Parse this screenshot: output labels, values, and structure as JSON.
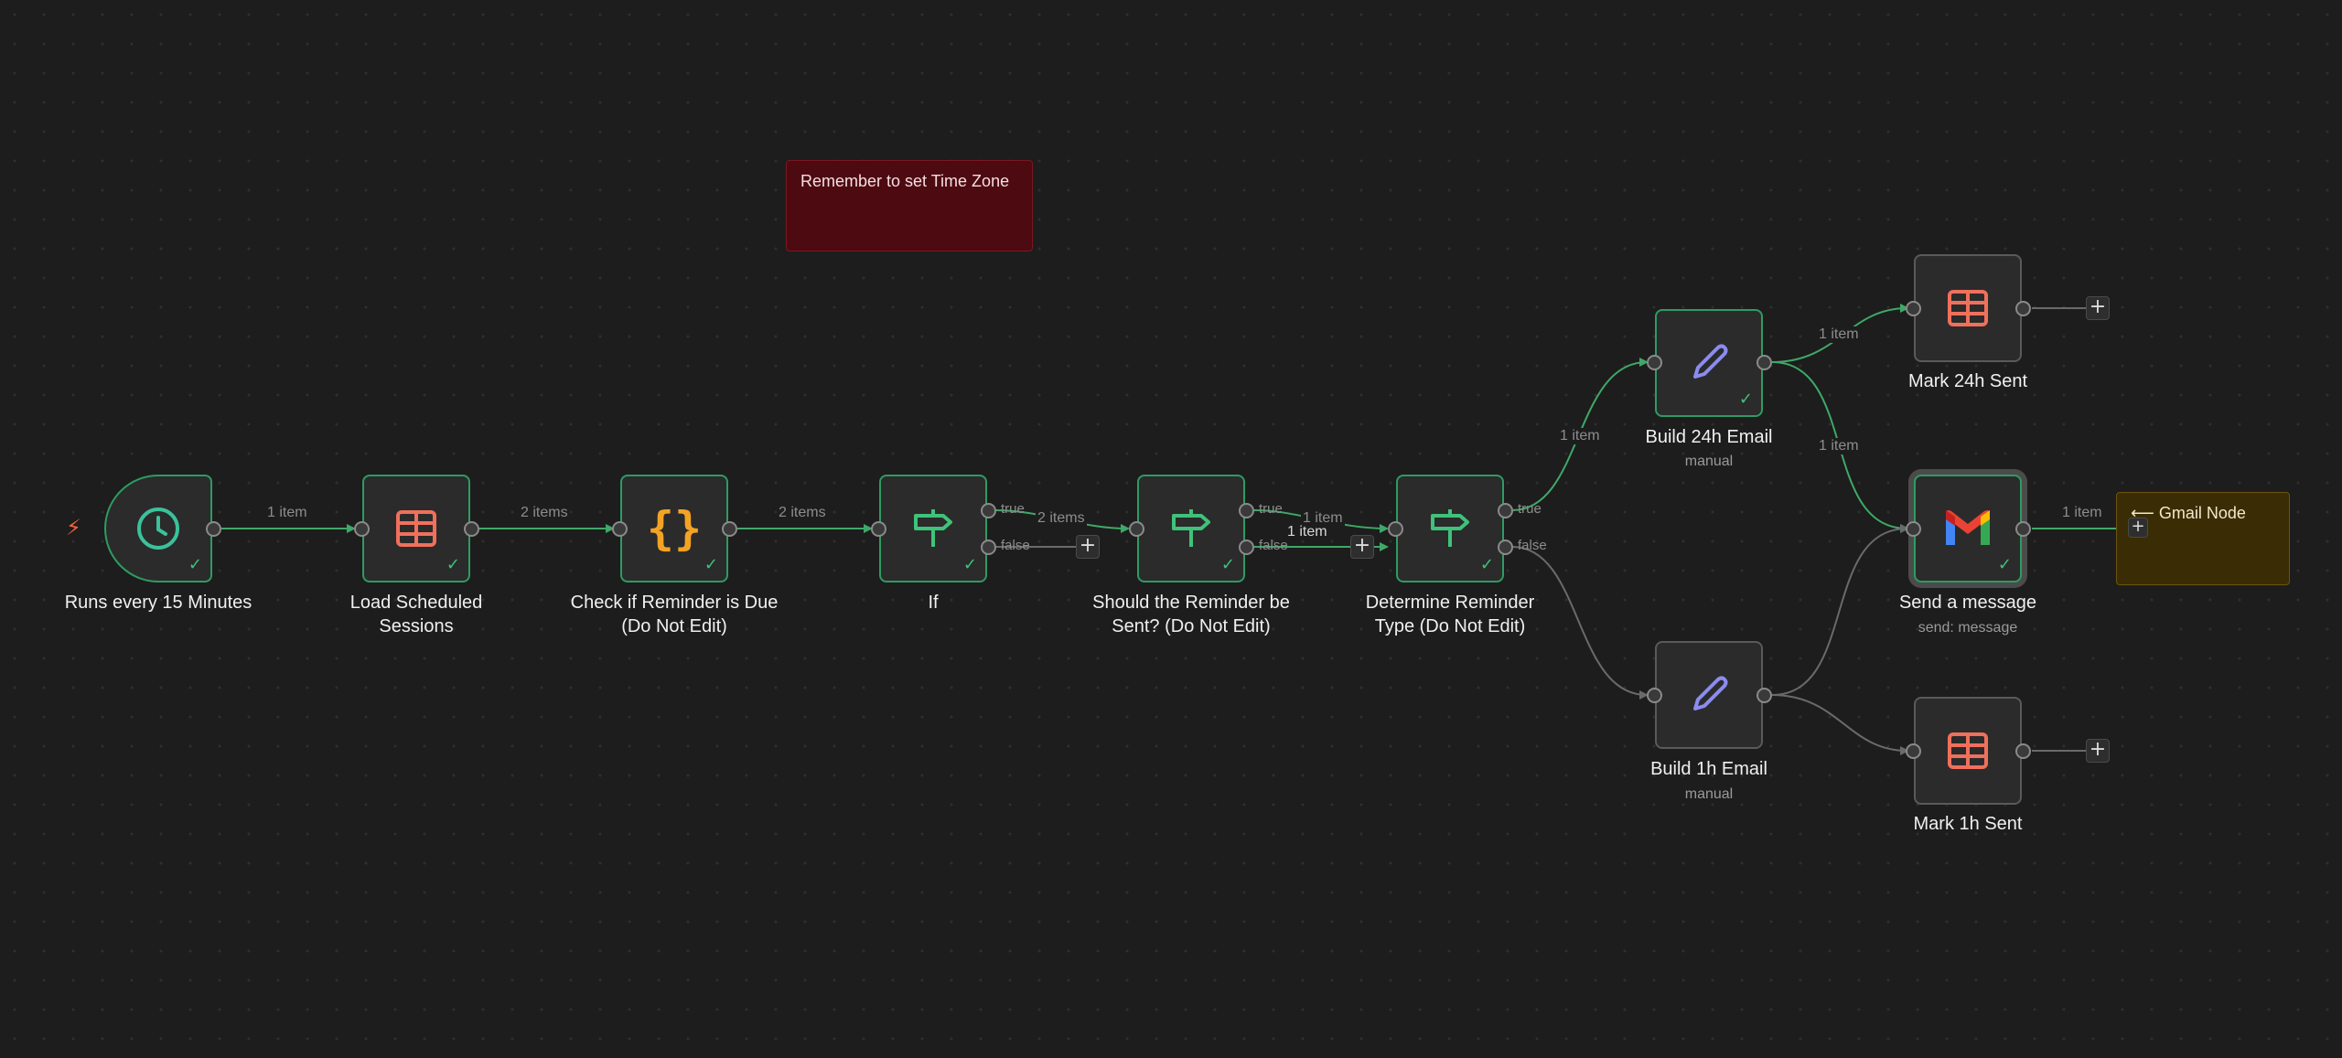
{
  "colors": {
    "active_edge": "#3fa868",
    "idle_edge": "#6a6a6a",
    "success": "#2e9b63",
    "canvas": "#1d1d1d"
  },
  "trigger_icon": "lightning-bolt-icon",
  "nodes": {
    "schedule": {
      "label": "Runs every 15 Minutes",
      "icon": "clock-icon"
    },
    "load": {
      "label_line1": "Load Scheduled",
      "label_line2": "Sessions",
      "icon": "table-icon"
    },
    "check": {
      "label_line1": "Check if Reminder is Due",
      "label_line2": "(Do Not Edit)",
      "icon": "code-braces-icon"
    },
    "if": {
      "label": "If",
      "icon": "signpost-icon"
    },
    "should": {
      "label_line1": "Should the Reminder be",
      "label_line2": "Sent? (Do Not Edit)",
      "icon": "signpost-icon"
    },
    "determine": {
      "label_line1": "Determine Reminder",
      "label_line2": "Type (Do Not Edit)",
      "icon": "signpost-icon"
    },
    "build24": {
      "label": "Build 24h Email",
      "sublabel": "manual",
      "icon": "pencil-icon"
    },
    "build1": {
      "label": "Build 1h Email",
      "sublabel": "manual",
      "icon": "pencil-icon"
    },
    "mark24": {
      "label": "Mark 24h Sent",
      "icon": "table-icon"
    },
    "mark1": {
      "label": "Mark 1h Sent",
      "icon": "table-icon"
    },
    "send": {
      "label": "Send a message",
      "sublabel": "send: message",
      "icon": "gmail-icon"
    }
  },
  "edges": {
    "e1": "1 item",
    "e2": "2 items",
    "e3": "2 items",
    "e4": "2 items",
    "e5": "1 item",
    "e5b": "1 item",
    "e6": "1 item",
    "e7": "1 item",
    "e8": "1 item",
    "e9": "1 item"
  },
  "ports": {
    "true": "true",
    "false": "false"
  },
  "plus": "+",
  "stickies": {
    "timezone": "Remember to set Time Zone",
    "gmail_arrow": "⟵",
    "gmail": "Gmail Node"
  }
}
